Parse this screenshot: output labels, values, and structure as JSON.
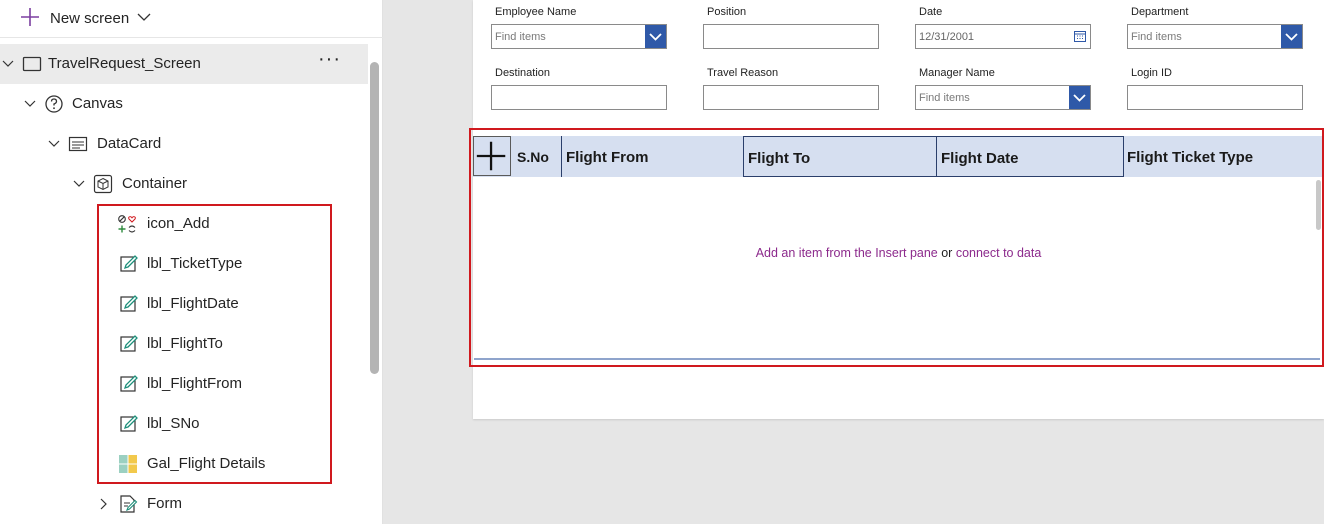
{
  "toolbar": {
    "new_screen_label": "New screen"
  },
  "tree": {
    "screen": {
      "label": "TravelRequest_Screen",
      "more": "···"
    },
    "canvas": {
      "label": "Canvas"
    },
    "datacard": {
      "label": "DataCard"
    },
    "container": {
      "label": "Container"
    },
    "children": [
      {
        "label": "icon_Add",
        "icon": "icon-control-icon"
      },
      {
        "label": "lbl_TicketType",
        "icon": "label-edit-icon"
      },
      {
        "label": "lbl_FlightDate",
        "icon": "label-edit-icon"
      },
      {
        "label": "lbl_FlightTo",
        "icon": "label-edit-icon"
      },
      {
        "label": "lbl_FlightFrom",
        "icon": "label-edit-icon"
      },
      {
        "label": "lbl_SNo",
        "icon": "label-edit-icon"
      },
      {
        "label": "Gal_Flight Details",
        "icon": "gallery-icon"
      }
    ],
    "form": {
      "label": "Form"
    }
  },
  "form": {
    "employee_name": {
      "label": "Employee Name",
      "placeholder": "Find items"
    },
    "position": {
      "label": "Position",
      "value": ""
    },
    "date": {
      "label": "Date",
      "value": "12/31/2001"
    },
    "department": {
      "label": "Department",
      "placeholder": "Find items"
    },
    "destination": {
      "label": "Destination",
      "value": ""
    },
    "travel_reason": {
      "label": "Travel Reason",
      "value": ""
    },
    "manager_name": {
      "label": "Manager Name",
      "placeholder": "Find items"
    },
    "login_id": {
      "label": "Login ID",
      "value": ""
    }
  },
  "gallery": {
    "headers": {
      "sno": "S.No",
      "flight_from": "Flight From",
      "flight_to": "Flight To",
      "flight_date": "Flight Date",
      "ticket_type": "Flight Ticket Type"
    },
    "empty_message": {
      "part1": "Add an item from the Insert pane",
      "part2": " or ",
      "part3": "connect to data"
    }
  },
  "colors": {
    "accent": "#2f59a8",
    "highlight": "#d0191e",
    "header_bg": "#d6dff0",
    "link": "#8c2a8c"
  }
}
